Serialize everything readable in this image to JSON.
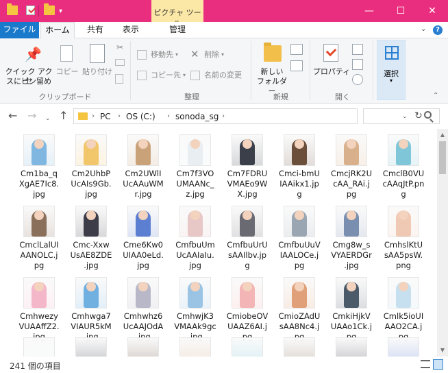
{
  "titlebar": {
    "context_tab": "ピクチャ ツール",
    "minimize": "—",
    "maximize": "☐",
    "close": "✕",
    "color": "#ea2e7f"
  },
  "tabs": {
    "file": "ファイル",
    "home": "ホーム",
    "share": "共有",
    "view": "表示",
    "manage": "管理"
  },
  "ribbon": {
    "pin_label_1": "クイック アクセ",
    "pin_label_2": "スにピン留め",
    "copy": "コピー",
    "paste": "貼り付け",
    "group_clipboard": "クリップボード",
    "move_to": "移動先",
    "copy_to": "コピー先",
    "delete": "削除",
    "rename": "名前の変更",
    "group_organize": "整理",
    "new_folder_1": "新しい",
    "new_folder_2": "フォルダー",
    "group_new": "新規",
    "properties": "プロパティ",
    "group_open": "開く",
    "select": "選択"
  },
  "address": {
    "crumbs": [
      "PC",
      "OS (C:)",
      "sonoda_sg"
    ]
  },
  "files": [
    {
      "line1": "Cm1ba_q",
      "line2": "XgAE7Ic8.",
      "line3": "jpg"
    },
    {
      "line1": "Cm2UhbP",
      "line2": "UcAIs9Gb.",
      "line3": "jpg"
    },
    {
      "line1": "Cm2UWlI",
      "line2": "UcAAuWM",
      "line3": "r.jpg"
    },
    {
      "line1": "Cm7f3VO",
      "line2": "UMAANc_",
      "line3": "z.jpg"
    },
    {
      "line1": "Cm7FDRU",
      "line2": "VMAEo9W",
      "line3": "X.jpg"
    },
    {
      "line1": "Cmci-bmU",
      "line2": "IAAikx1.jp",
      "line3": "g"
    },
    {
      "line1": "CmcjRK2U",
      "line2": "cAA_RAi.j",
      "line3": "pg"
    },
    {
      "line1": "CmclB0VU",
      "line2": "cAAqJtP.pn",
      "line3": "g"
    },
    {
      "line1": "CmclLalUI",
      "line2": "AANOLC.j",
      "line3": "pg"
    },
    {
      "line1": "Cmc-Xxw",
      "line2": "UsAE8ZDE",
      "line3": ".jpg"
    },
    {
      "line1": "Cme6Kw0",
      "line2": "UIAA0eLd.",
      "line3": "jpg"
    },
    {
      "line1": "CmfbuUm",
      "line2": "UcAAIaIu.",
      "line3": "jpg"
    },
    {
      "line1": "CmfbuUrU",
      "line2": "sAAIlbv.jp",
      "line3": "g"
    },
    {
      "line1": "CmfbuUuV",
      "line2": "IAALOCe.j",
      "line3": "pg"
    },
    {
      "line1": "Cmg8w_s",
      "line2": "VYAERDGr",
      "line3": ".jpg"
    },
    {
      "line1": "CmhslKtU",
      "line2": "sAA5psW.",
      "line3": "png"
    },
    {
      "line1": "Cmhwezy",
      "line2": "VUAAffZ2.",
      "line3": "jpg"
    },
    {
      "line1": "Cmhwga7",
      "line2": "VIAUR5kM",
      "line3": ".jpg"
    },
    {
      "line1": "Cmhwhz6",
      "line2": "UcAAJOdA",
      "line3": ".jpg"
    },
    {
      "line1": "CmhwjK3",
      "line2": "VMAAk9gc",
      "line3": ".jpg"
    },
    {
      "line1": "CmiobeOV",
      "line2": "UAAZ6AI.j",
      "line3": "pg"
    },
    {
      "line1": "CmioZAdU",
      "line2": "sAA8Nc4.j",
      "line3": "pg"
    },
    {
      "line1": "CmkiHjkV",
      "line2": "UAAo1Ck.j",
      "line3": "pg"
    },
    {
      "line1": "Cmlk5ioUI",
      "line2": "AAO2CA.j",
      "line3": "pg"
    }
  ],
  "thumb_colors": [
    "#7fb7e0",
    "#f2c66a",
    "#c9a27a",
    "#e9eef3",
    "#3a3f4a",
    "#6b4f3a",
    "#d9b08c",
    "#7fc6d8",
    "#8a6f5a",
    "#3d3d4a",
    "#5c7fd1",
    "#e8c7c7",
    "#6a6a72",
    "#9aa6b2",
    "#7a8fb0",
    "#f0c9b5",
    "#f4b7c9",
    "#6fb0e0",
    "#b8b8c8",
    "#9bc4e4",
    "#f3b5b5",
    "#e0a07a",
    "#4c5b6a",
    "#c7e0ef"
  ],
  "status": {
    "item_count": "241 個の項目"
  }
}
